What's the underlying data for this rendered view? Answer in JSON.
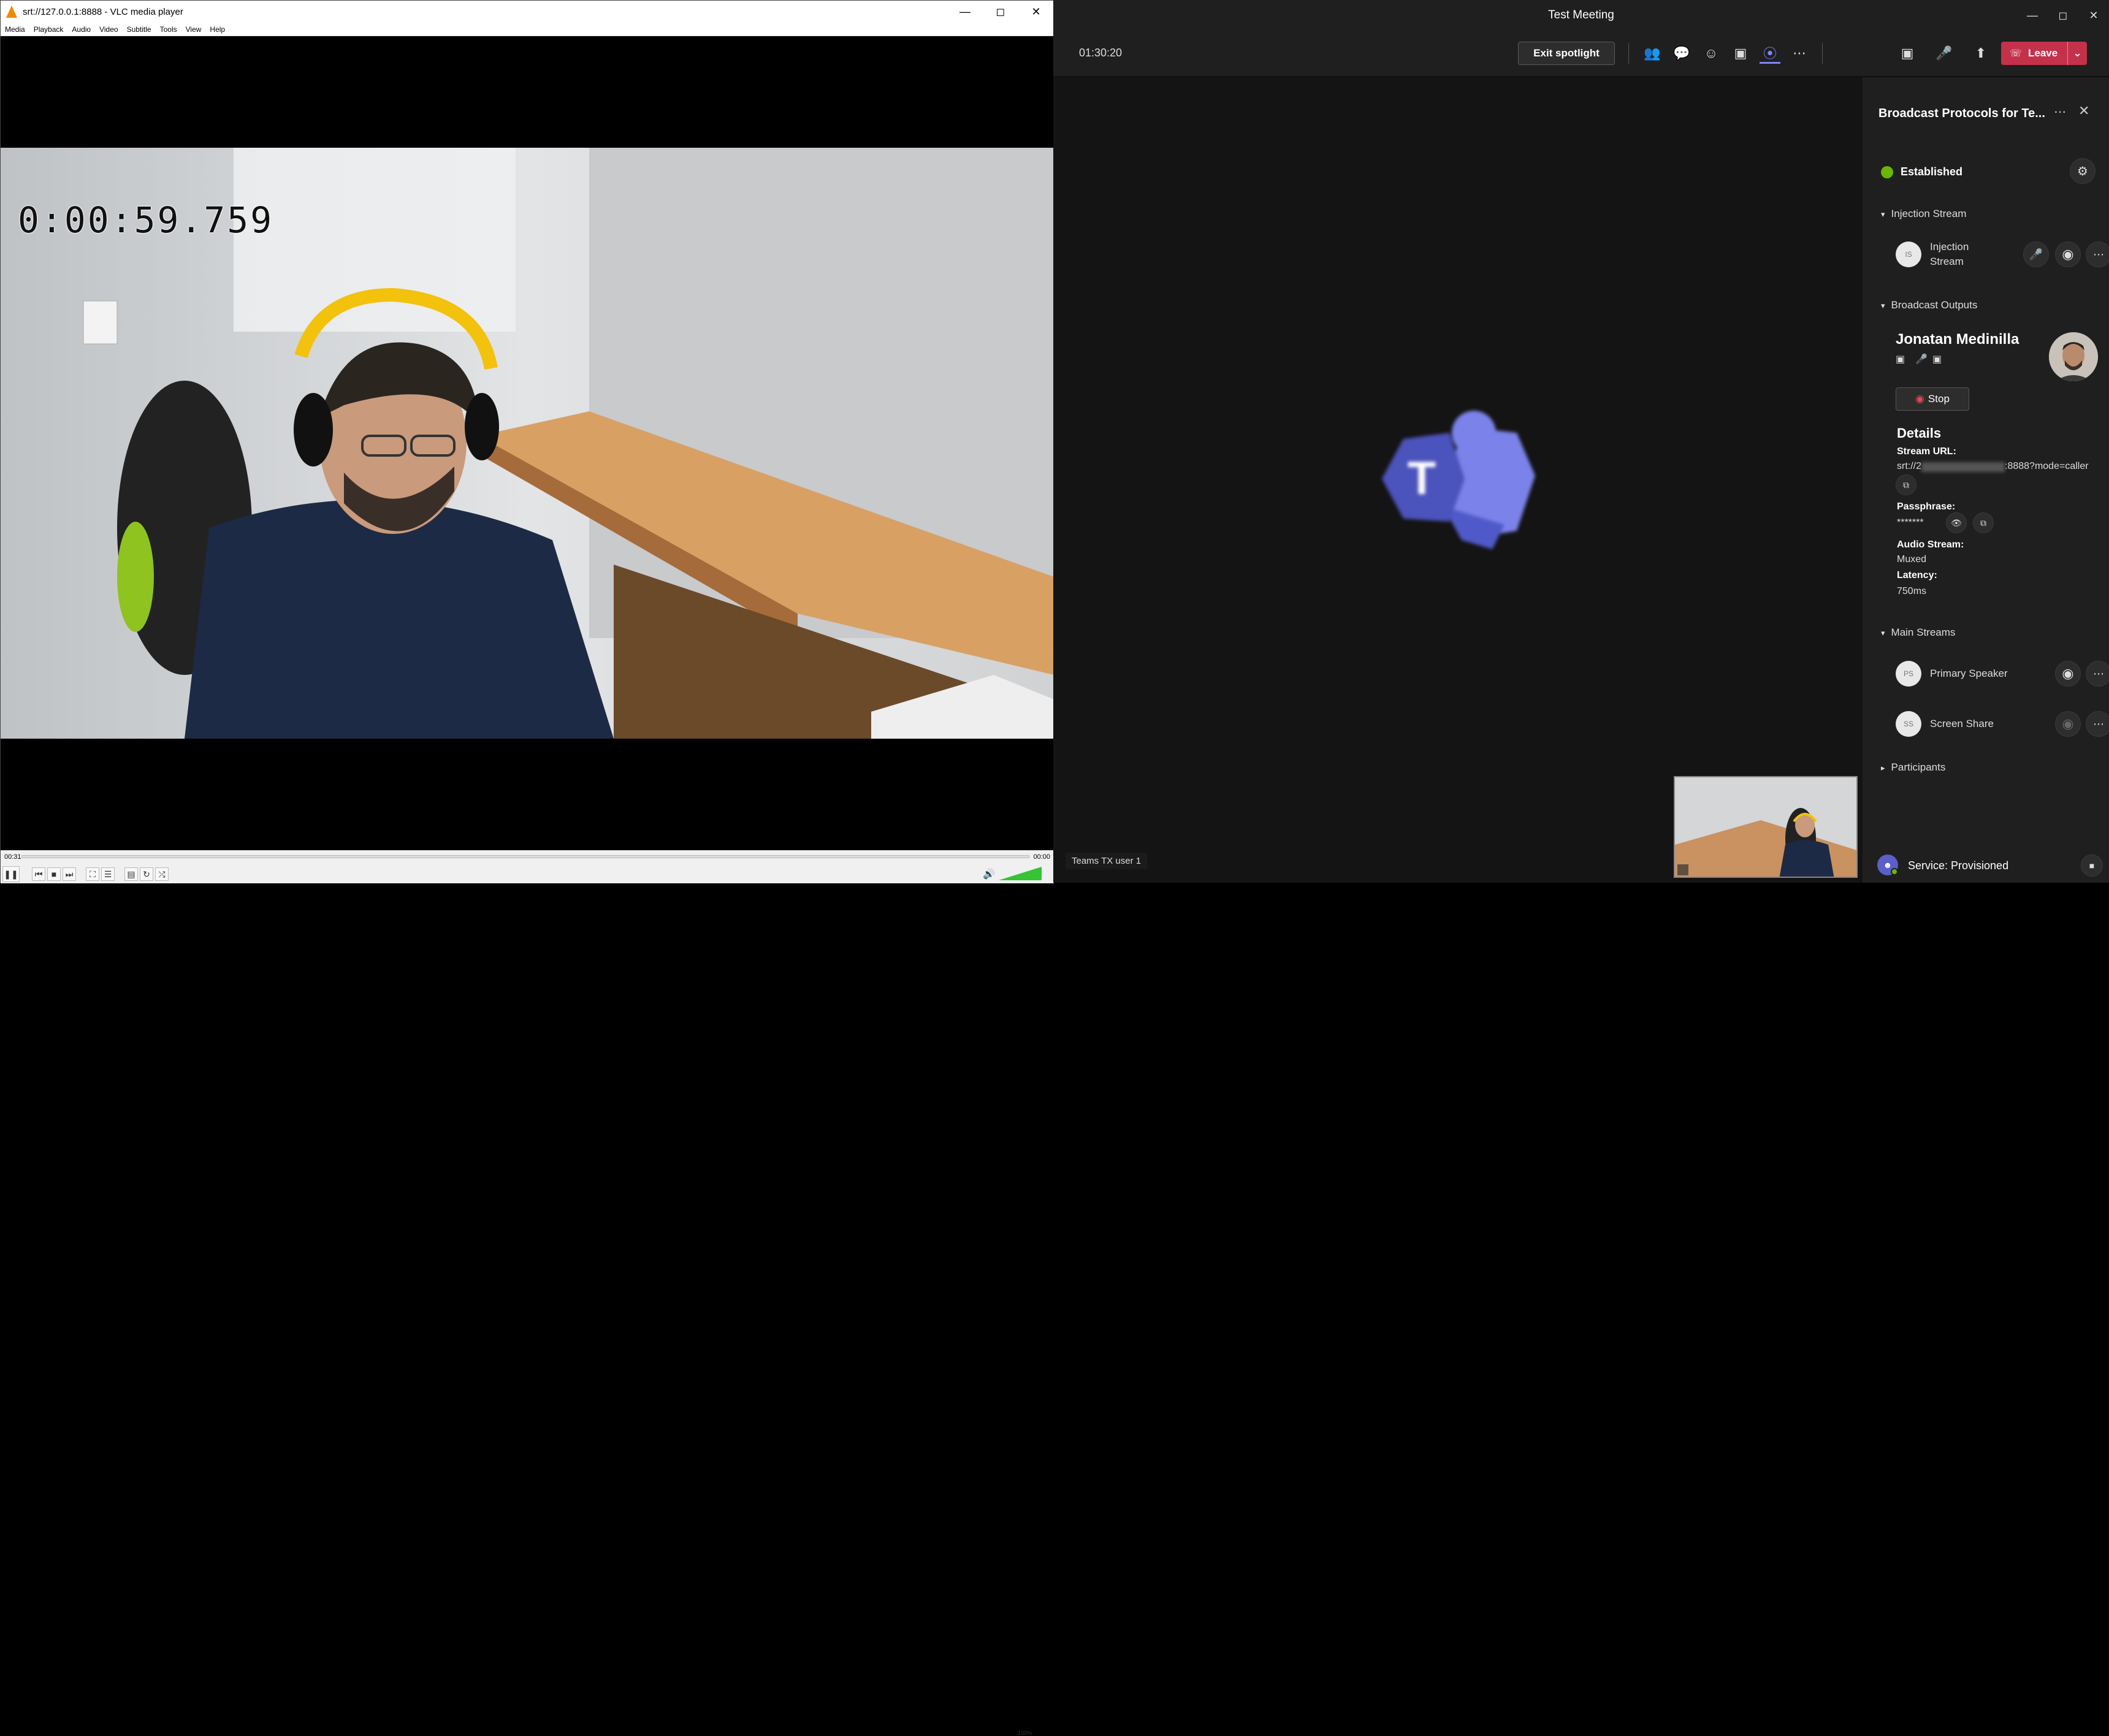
{
  "vlc": {
    "title": "srt://127.0.0.1:8888 - VLC media player",
    "menu": [
      "Media",
      "Playback",
      "Audio",
      "Video",
      "Subtitle",
      "Tools",
      "View",
      "Help"
    ],
    "timecode": "0:00:59.759",
    "elapsed": "00:31",
    "duration": "00:00",
    "volume": "100%",
    "volume_level": 1.0,
    "window_buttons": [
      "minimize-icon",
      "maximize-icon",
      "close-icon"
    ],
    "accent": "#f08a00"
  },
  "teams": {
    "window_title": "Test Meeting",
    "timer": "01:30:20",
    "exit_spotlight": "Exit spotlight",
    "leave": "Leave",
    "toolbar_icons": [
      "people-icon",
      "chat-icon",
      "reactions-icon",
      "rooms-icon",
      "broadcast-icon",
      "more-icon",
      "camera-icon",
      "mic-icon",
      "share-icon"
    ],
    "participant_tag": "Teams TX user 1",
    "leave_color": "#c4314b",
    "panel": {
      "title": "Broadcast Protocols for Te...",
      "status": "Established",
      "status_color": "#6bb700",
      "injection_header": "Injection Stream",
      "injection": {
        "initials": "IS",
        "label_line1": "Injection",
        "label_line2": "Stream"
      },
      "outputs_header": "Broadcast Outputs",
      "person_name": "Jonatan Medinilla",
      "stop": "Stop",
      "details_title": "Details",
      "stream_url_label": "Stream URL:",
      "stream_url_prefix": "srt://2",
      "stream_url_suffix": ":8888?mode=caller",
      "passphrase_label": "Passphrase:",
      "passphrase": "*******",
      "audio_label": "Audio Stream:",
      "audio_value": "Muxed",
      "latency_label": "Latency:",
      "latency_value": "750ms",
      "main_header": "Main Streams",
      "main_streams": [
        {
          "initials": "PS",
          "label": "Primary Speaker"
        },
        {
          "initials": "SS",
          "label": "Screen Share"
        }
      ],
      "participants_header": "Participants",
      "service": "Service: Provisioned"
    }
  }
}
